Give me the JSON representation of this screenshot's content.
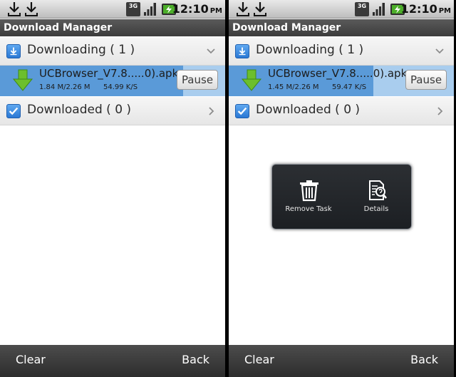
{
  "screens": [
    {
      "status_bar": {
        "time": "12:10",
        "ampm": "PM",
        "network": "3G"
      },
      "title": "Download Manager",
      "downloading": {
        "label": "Downloading ( 1 )"
      },
      "download_item": {
        "filename": "UCBrowser_V7.8.....0).apk",
        "size": "1.84 M/2.26 M",
        "speed": "54.99 K/S",
        "progress": 0.814,
        "pause_label": "Pause"
      },
      "downloaded": {
        "label": "Downloaded ( 0 )"
      },
      "bottom_bar": {
        "clear_label": "Clear",
        "back_label": "Back"
      }
    },
    {
      "status_bar": {
        "time": "12:10",
        "ampm": "PM",
        "network": "3G"
      },
      "title": "Download Manager",
      "downloading": {
        "label": "Downloading ( 1 )"
      },
      "download_item": {
        "filename": "UCBrowser_V7.8.....0).apk",
        "size": "1.45 M/2.26 M",
        "speed": "59.47 K/S",
        "progress": 0.642,
        "pause_label": "Pause"
      },
      "downloaded": {
        "label": "Downloaded ( 0 )"
      },
      "context_menu": {
        "remove_label": "Remove Task",
        "details_label": "Details"
      },
      "bottom_bar": {
        "clear_label": "Clear",
        "back_label": "Back"
      }
    }
  ],
  "colors": {
    "progress_fill": "#5a9ad8",
    "progress_track": "#a9cdee",
    "download_arrow": "#6cbf2c",
    "section_icon": "#2a78d4"
  },
  "icons": {
    "status_download": "download-arrow-icon",
    "network": "3g-icon",
    "signal": "signal-bars-icon",
    "battery": "battery-charging-icon",
    "downloading": "download-box-icon",
    "downloaded": "checkbox-check-icon",
    "expanded": "chevron-down-icon",
    "collapsed": "chevron-right-icon",
    "remove": "trash-icon",
    "details": "document-search-icon"
  }
}
